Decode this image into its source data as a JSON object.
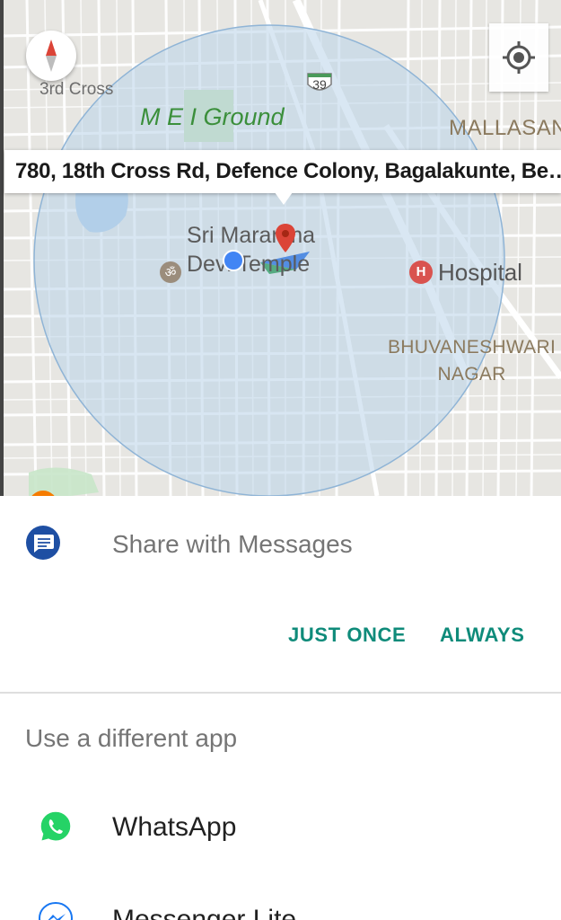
{
  "map": {
    "address": "780, 18th Cross Rd, Defence Colony, Bagalakunte, Be…",
    "labels": {
      "third_cross": "3rd Cross",
      "ground": "M E I Ground",
      "mallasand": "MALLASAND",
      "temple_line1": "Sri Maranma",
      "temple_line2": "Devi Temple",
      "hospital": "Hospital",
      "bhuv_line1": "BHUVANESHWARI",
      "bhuv_line2": "NAGAR"
    },
    "road_shield": "39",
    "colors": {
      "accuracy_circle": "#b9d3ea",
      "my_location": "#4285f4",
      "pin": "#db4437",
      "park": "#c8e2b3",
      "water": "#a9cbe8"
    }
  },
  "sheet": {
    "share_label": "Share with Messages",
    "just_once": "JUST ONCE",
    "always": "ALWAYS",
    "different_app": "Use a different app",
    "apps": [
      {
        "name": "WhatsApp",
        "icon": "whatsapp-icon"
      },
      {
        "name": "Messenger Lite",
        "icon": "messenger-lite-icon"
      }
    ],
    "colors": {
      "accent": "#0f8b7a",
      "messages_icon": "#1e4fa3",
      "whatsapp": "#25d366"
    }
  }
}
